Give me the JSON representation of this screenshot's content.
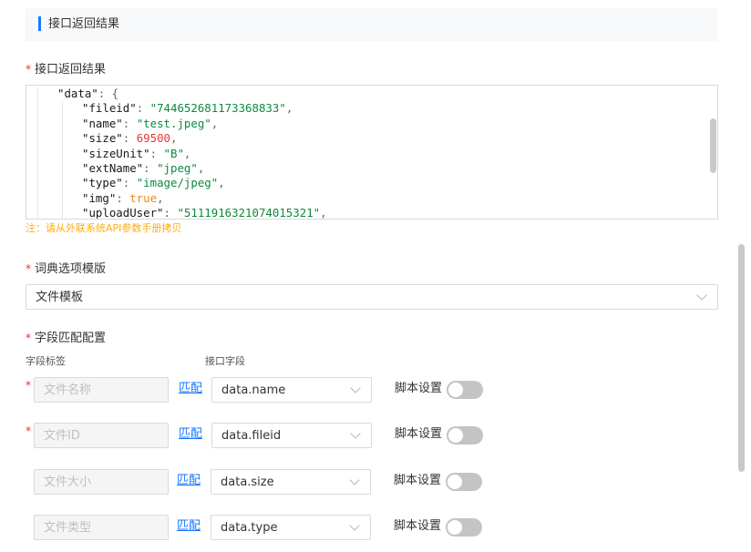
{
  "section": {
    "title": "接口返回结果"
  },
  "result_field": {
    "label": "接口返回结果",
    "required_mark": "*",
    "code_lines": [
      {
        "indent": 1,
        "parts": [
          [
            "k",
            "\"data\""
          ],
          [
            "p",
            ": {"
          ]
        ]
      },
      {
        "indent": 2,
        "parts": [
          [
            "k",
            "\"fileid\""
          ],
          [
            "p",
            ": "
          ],
          [
            "s",
            "\"744652681173368833\""
          ],
          [
            "p",
            ","
          ]
        ]
      },
      {
        "indent": 2,
        "parts": [
          [
            "k",
            "\"name\""
          ],
          [
            "p",
            ": "
          ],
          [
            "s",
            "\"test.jpeg\""
          ],
          [
            "p",
            ","
          ]
        ]
      },
      {
        "indent": 2,
        "parts": [
          [
            "k",
            "\"size\""
          ],
          [
            "p",
            ": "
          ],
          [
            "n",
            "69500"
          ],
          [
            "p",
            ","
          ]
        ]
      },
      {
        "indent": 2,
        "parts": [
          [
            "k",
            "\"sizeUnit\""
          ],
          [
            "p",
            ": "
          ],
          [
            "s",
            "\"B\""
          ],
          [
            "p",
            ","
          ]
        ]
      },
      {
        "indent": 2,
        "parts": [
          [
            "k",
            "\"extName\""
          ],
          [
            "p",
            ": "
          ],
          [
            "s",
            "\"jpeg\""
          ],
          [
            "p",
            ","
          ]
        ]
      },
      {
        "indent": 2,
        "parts": [
          [
            "k",
            "\"type\""
          ],
          [
            "p",
            ": "
          ],
          [
            "s",
            "\"image/jpeg\""
          ],
          [
            "p",
            ","
          ]
        ]
      },
      {
        "indent": 2,
        "parts": [
          [
            "k",
            "\"img\""
          ],
          [
            "p",
            ": "
          ],
          [
            "b",
            "true"
          ],
          [
            "p",
            ","
          ]
        ]
      },
      {
        "indent": 2,
        "parts": [
          [
            "k",
            "\"uploadUser\""
          ],
          [
            "p",
            ": "
          ],
          [
            "s",
            "\"5111916321074015321\""
          ],
          [
            "p",
            ","
          ]
        ]
      }
    ],
    "note": "注：请从外联系统API参数手册拷贝"
  },
  "dict_template": {
    "label": "词典选项模版",
    "required_mark": "*",
    "value": "文件模板"
  },
  "field_mapping": {
    "label": "字段匹配配置",
    "required_mark": "*",
    "col_field_label": "字段标签",
    "col_api_field": "接口字段",
    "match_label": "匹配",
    "script_label": "脚本设置",
    "rows": [
      {
        "required": true,
        "placeholder": "文件名称",
        "api_field": "data.name",
        "script_enabled": false
      },
      {
        "required": true,
        "placeholder": "文件ID",
        "api_field": "data.fileid",
        "script_enabled": false
      },
      {
        "required": false,
        "placeholder": "文件大小",
        "api_field": "data.size",
        "script_enabled": false
      },
      {
        "required": false,
        "placeholder": "文件类型",
        "api_field": "data.type",
        "script_enabled": false
      }
    ]
  },
  "colors": {
    "accent": "#1677ff",
    "required": "#f5222d",
    "note": "#faad14",
    "toggle_off": "#c4c4c4"
  },
  "icons": [
    "chevron-down-icon"
  ]
}
